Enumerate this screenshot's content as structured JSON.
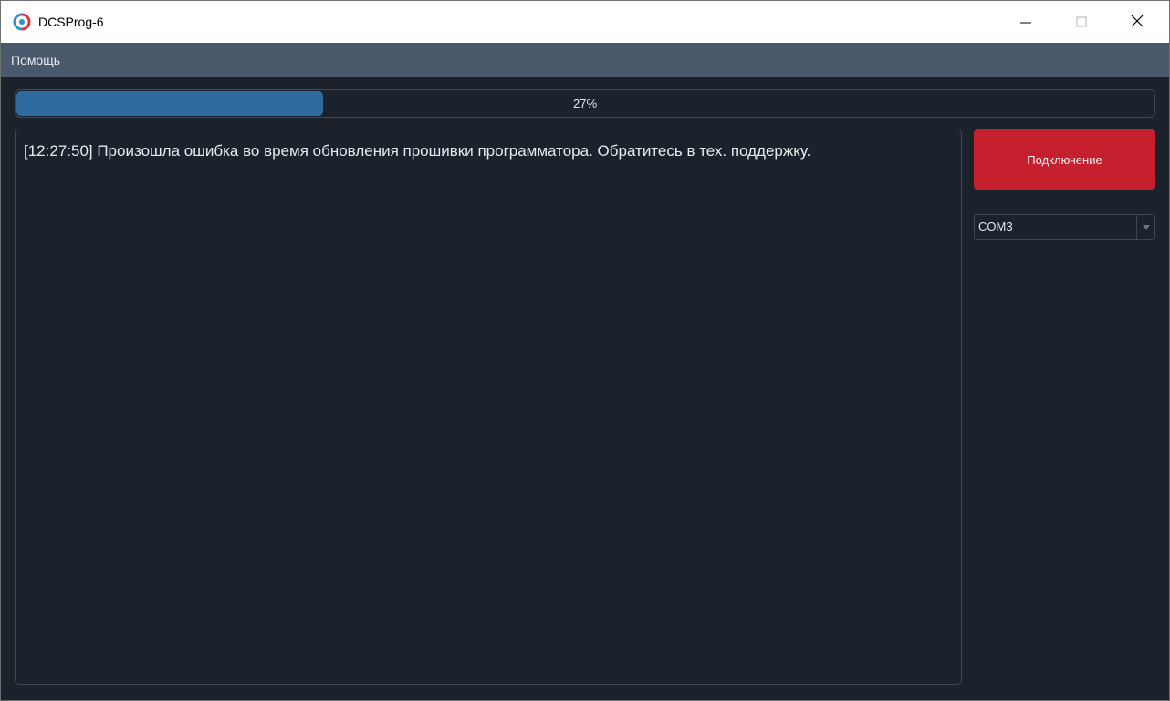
{
  "window": {
    "title": "DCSProg-6"
  },
  "menu": {
    "help_first_letter": "П",
    "help_rest": "омощь"
  },
  "progress": {
    "value": 0.27,
    "label": "27%",
    "fill_color": "#2f6aa0"
  },
  "log": {
    "lines": [
      "[12:27:50] Произошла ошибка во время обновления прошивки программатора. Обратитесь в тех. поддержку."
    ]
  },
  "controls": {
    "connect_label": "Подключение",
    "connect_color": "#c6202f",
    "port_value": "COM3"
  },
  "icons": {
    "app": "app-logo-icon",
    "minimize": "minimize-icon",
    "maximize": "maximize-icon",
    "close": "close-icon",
    "dropdown": "chevron-down-icon"
  }
}
